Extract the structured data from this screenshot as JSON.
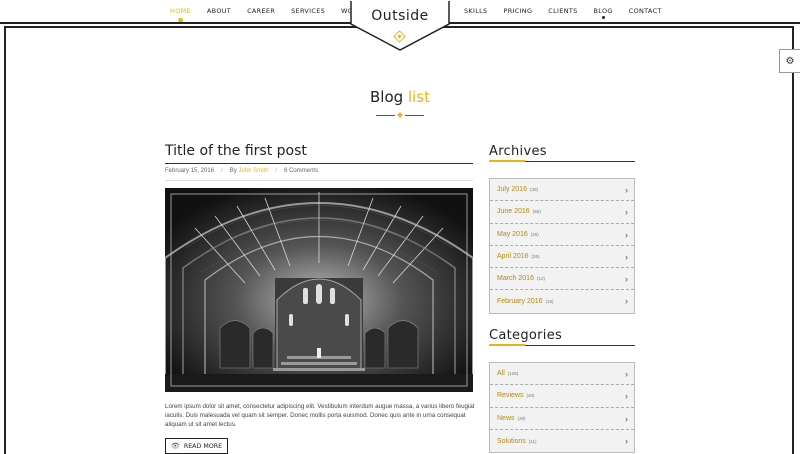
{
  "nav": {
    "left": [
      {
        "label": "Home",
        "active": true
      },
      {
        "label": "About"
      },
      {
        "label": "Career"
      },
      {
        "label": "Services"
      },
      {
        "label": "Works"
      }
    ],
    "right": [
      {
        "label": "Skills"
      },
      {
        "label": "Pricing"
      },
      {
        "label": "Clients"
      },
      {
        "label": "Blog",
        "current": true
      },
      {
        "label": "Contact"
      }
    ]
  },
  "logo": {
    "text": "Outside"
  },
  "page_title": {
    "main": "Blog",
    "accent": "list"
  },
  "post": {
    "title": "Title of the first post",
    "date": "February 15, 2016",
    "by_label": "By",
    "author": "John Smith",
    "comments": "6 Comments",
    "excerpt": "Lorem ipsum dolor sit amet, consectetur adipiscing elit. Vestibulum interdum augue massa, a varius libero feugiat iaculis. Duis malesuada vel quam sit semper. Donec mollis porta euismod. Donec quis ante in urna consequat aliquam ut sit amet lectus.",
    "read_more": "Read More"
  },
  "archives": {
    "title": "Archives",
    "items": [
      {
        "label": "July 2016",
        "count": "(40)"
      },
      {
        "label": "June 2016",
        "count": "(55)"
      },
      {
        "label": "May 2016",
        "count": "(29)"
      },
      {
        "label": "April 2016",
        "count": "(26)"
      },
      {
        "label": "March 2016",
        "count": "(12)"
      },
      {
        "label": "February 2016",
        "count": "(18)"
      }
    ]
  },
  "categories": {
    "title": "Categories",
    "items": [
      {
        "label": "All",
        "count": "(126)"
      },
      {
        "label": "Reviews",
        "count": "(40)"
      },
      {
        "label": "News",
        "count": "(29)"
      },
      {
        "label": "Solutions",
        "count": "(11)"
      }
    ]
  },
  "colors": {
    "accent": "#e8b517",
    "text": "#222222"
  }
}
